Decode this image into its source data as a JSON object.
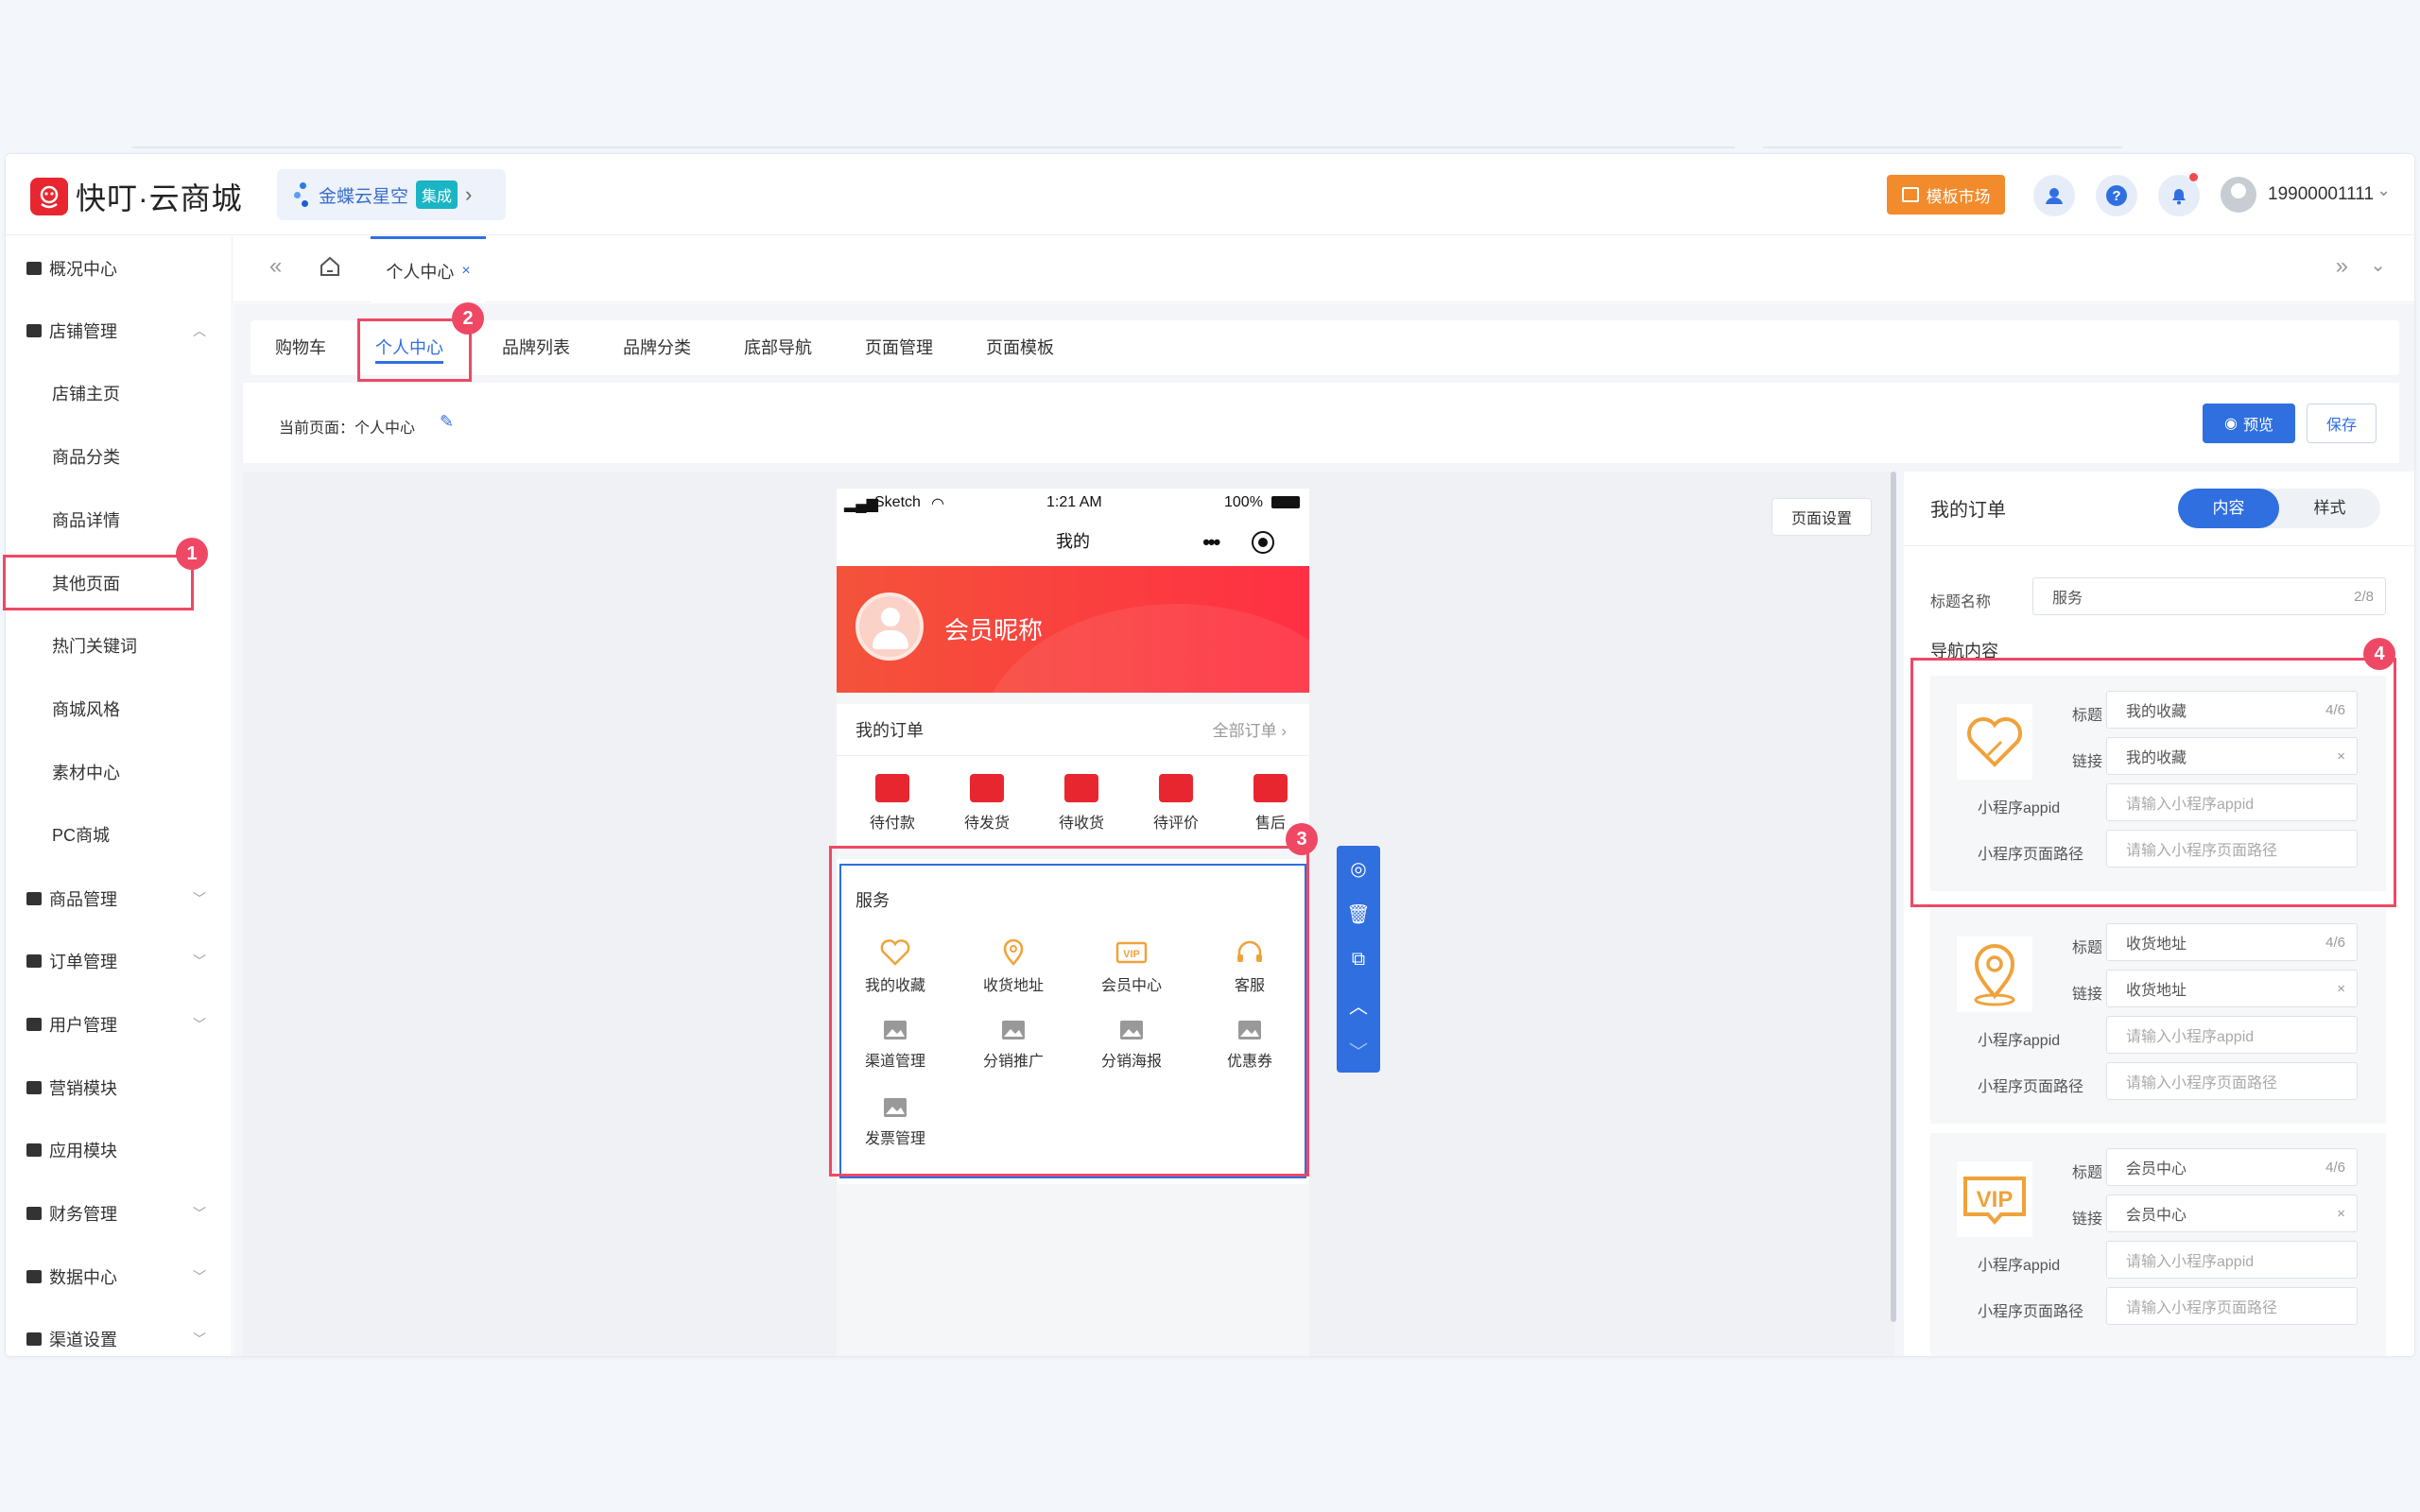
{
  "header": {
    "logo_text": "快叮·云商城",
    "kingdee_text": "金蝶云星空",
    "kingdee_badge": "集成",
    "template_market": "模板市场",
    "help_glyph": "?",
    "username": "19900001111",
    "icons": [
      "logo-icon",
      "kingdee-icon",
      "customer-service-icon",
      "help-icon",
      "bell-icon",
      "avatar-icon"
    ]
  },
  "sidebar": {
    "items": [
      {
        "label": "概况中心",
        "type": "top"
      },
      {
        "label": "店铺管理",
        "type": "top",
        "expanded": true
      },
      {
        "label": "店铺主页",
        "type": "sub"
      },
      {
        "label": "商品分类",
        "type": "sub"
      },
      {
        "label": "商品详情",
        "type": "sub"
      },
      {
        "label": "其他页面",
        "type": "sub"
      },
      {
        "label": "热门关键词",
        "type": "sub"
      },
      {
        "label": "商城风格",
        "type": "sub"
      },
      {
        "label": "素材中心",
        "type": "sub"
      },
      {
        "label": "PC商城",
        "type": "sub"
      },
      {
        "label": "商品管理",
        "type": "top"
      },
      {
        "label": "订单管理",
        "type": "top"
      },
      {
        "label": "用户管理",
        "type": "top"
      },
      {
        "label": "营销模块",
        "type": "top"
      },
      {
        "label": "应用模块",
        "type": "top"
      },
      {
        "label": "财务管理",
        "type": "top"
      },
      {
        "label": "数据中心",
        "type": "top"
      },
      {
        "label": "渠道设置",
        "type": "top"
      }
    ]
  },
  "tabbar": {
    "active_tab": "个人中心",
    "close": "×"
  },
  "subnav": {
    "items": [
      "购物车",
      "个人中心",
      "品牌列表",
      "品牌分类",
      "底部导航",
      "页面管理",
      "页面模板"
    ],
    "active": "个人中心"
  },
  "current": {
    "label": "当前页面：个人中心",
    "preview": "预览",
    "save": "保存"
  },
  "page_settings": "页面设置",
  "phone": {
    "signal": "Sketch",
    "time": "1:21 AM",
    "battery": "100%",
    "title": "我的",
    "member_name": "会员昵称",
    "orders_title": "我的订单",
    "orders_all": "全部订单",
    "order_items": [
      "待付款",
      "待发货",
      "待收货",
      "待评价",
      "售后"
    ],
    "service_title": "服务",
    "service_items": [
      "我的收藏",
      "收货地址",
      "会员中心",
      "客服",
      "渠道管理",
      "分销推广",
      "分销海报",
      "优惠券",
      "发票管理"
    ]
  },
  "annotations": [
    "1",
    "2",
    "3",
    "4"
  ],
  "panel": {
    "title": "我的订单",
    "seg_on": "内容",
    "seg_off": "样式",
    "title_label": "标题名称",
    "title_value": "服务",
    "title_count": "2/8",
    "nav_title": "导航内容",
    "labels": {
      "title": "标题",
      "link": "链接",
      "appid": "小程序appid",
      "path": "小程序页面路径"
    },
    "appid_placeholder": "请输入小程序appid",
    "path_placeholder": "请输入小程序页面路径",
    "cards": [
      {
        "title": "我的收藏",
        "count": "4/6",
        "link": "我的收藏",
        "icon": "heart-icon"
      },
      {
        "title": "收货地址",
        "count": "4/6",
        "link": "收货地址",
        "icon": "location-icon"
      },
      {
        "title": "会员中心",
        "count": "4/6",
        "link": "会员中心",
        "icon": "vip-icon"
      }
    ],
    "clear": "×"
  },
  "colors": {
    "primary": "#2f6fe0",
    "brand_red": "#e8262f",
    "accent_orange": "#f28b2c",
    "annotation": "#ef4865",
    "icon_orange": "#f0a23a"
  }
}
